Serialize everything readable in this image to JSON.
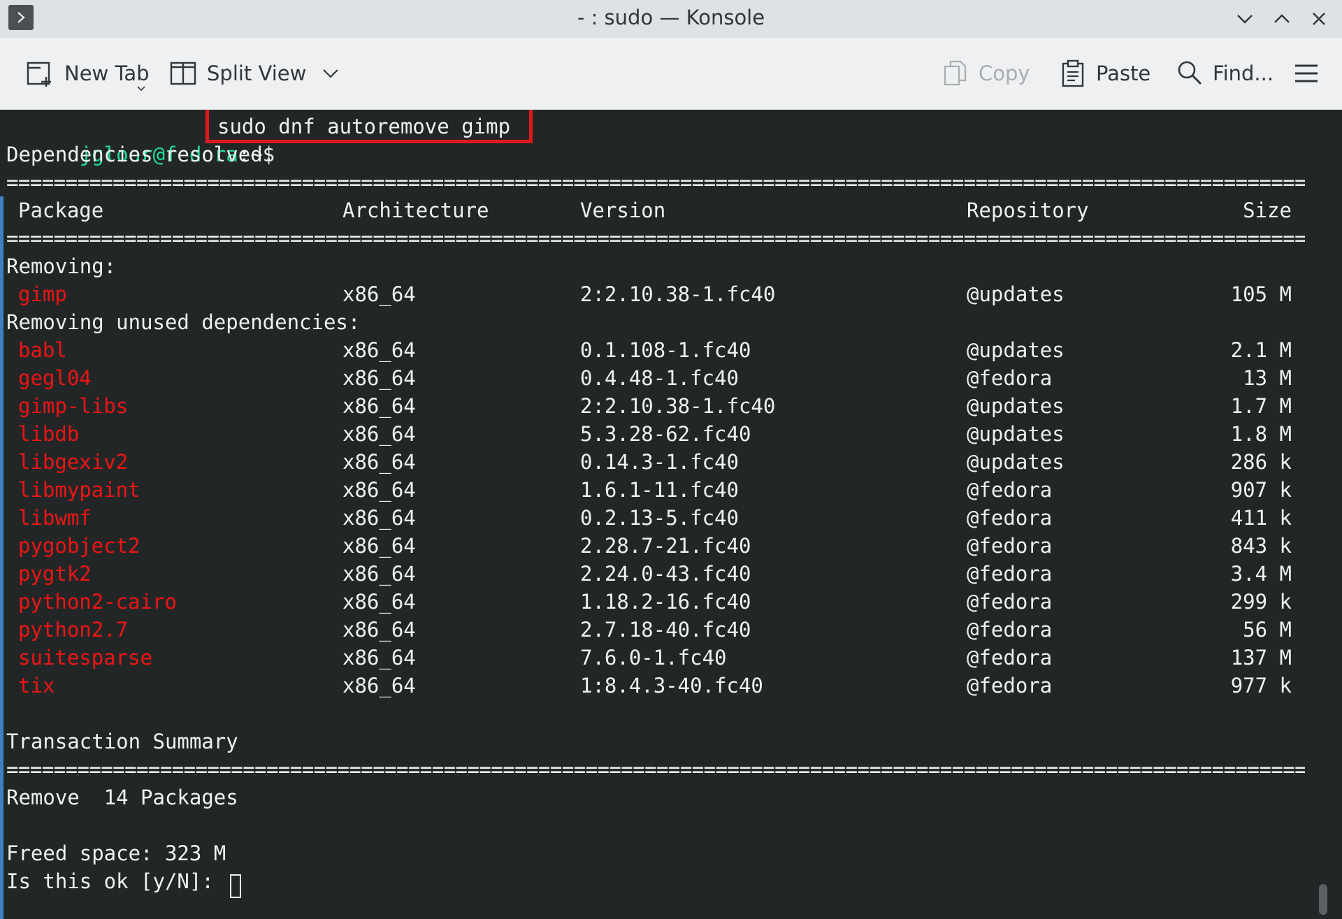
{
  "window": {
    "title": "- : sudo — Konsole",
    "controls": [
      "minimize",
      "maximize",
      "close"
    ]
  },
  "toolbar": {
    "new_tab": "New Tab",
    "split_view": "Split View",
    "copy": "Copy",
    "paste": "Paste",
    "find": "Find...",
    "menu_icon": "hamburger-menu-icon"
  },
  "terminal": {
    "prompt_user": "jgloor@fedora",
    "prompt_suffix": ":~$",
    "command": "sudo dnf autoremove gimp",
    "line_resolved": "Dependencies resolved.",
    "separator": "================================================================================================================",
    "headers": {
      "package": "Package",
      "arch": "Architecture",
      "version": "Version",
      "repo": "Repository",
      "size": "Size"
    },
    "section_removing": "Removing:",
    "section_unused": "Removing unused dependencies:",
    "removing": [
      {
        "name": "gimp",
        "arch": "x86_64",
        "version": "2:2.10.38-1.fc40",
        "repo": "@updates",
        "size": "105 M"
      }
    ],
    "dependencies": [
      {
        "name": "babl",
        "arch": "x86_64",
        "version": "0.1.108-1.fc40",
        "repo": "@updates",
        "size": "2.1 M"
      },
      {
        "name": "gegl04",
        "arch": "x86_64",
        "version": "0.4.48-1.fc40",
        "repo": "@fedora",
        "size": "13 M"
      },
      {
        "name": "gimp-libs",
        "arch": "x86_64",
        "version": "2:2.10.38-1.fc40",
        "repo": "@updates",
        "size": "1.7 M"
      },
      {
        "name": "libdb",
        "arch": "x86_64",
        "version": "5.3.28-62.fc40",
        "repo": "@updates",
        "size": "1.8 M"
      },
      {
        "name": "libgexiv2",
        "arch": "x86_64",
        "version": "0.14.3-1.fc40",
        "repo": "@updates",
        "size": "286 k"
      },
      {
        "name": "libmypaint",
        "arch": "x86_64",
        "version": "1.6.1-11.fc40",
        "repo": "@fedora",
        "size": "907 k"
      },
      {
        "name": "libwmf",
        "arch": "x86_64",
        "version": "0.2.13-5.fc40",
        "repo": "@fedora",
        "size": "411 k"
      },
      {
        "name": "pygobject2",
        "arch": "x86_64",
        "version": "2.28.7-21.fc40",
        "repo": "@fedora",
        "size": "843 k"
      },
      {
        "name": "pygtk2",
        "arch": "x86_64",
        "version": "2.24.0-43.fc40",
        "repo": "@fedora",
        "size": "3.4 M"
      },
      {
        "name": "python2-cairo",
        "arch": "x86_64",
        "version": "1.18.2-16.fc40",
        "repo": "@fedora",
        "size": "299 k"
      },
      {
        "name": "python2.7",
        "arch": "x86_64",
        "version": "2.7.18-40.fc40",
        "repo": "@fedora",
        "size": "56 M"
      },
      {
        "name": "suitesparse",
        "arch": "x86_64",
        "version": "7.6.0-1.fc40",
        "repo": "@fedora",
        "size": "137 M"
      },
      {
        "name": "tix",
        "arch": "x86_64",
        "version": "1:8.4.3-40.fc40",
        "repo": "@fedora",
        "size": "977 k"
      }
    ],
    "summary_title": "Transaction Summary",
    "remove_line": "Remove  14 Packages",
    "freed_line": "Freed space: 323 M",
    "confirm_prompt": "Is this ok [y/N]: "
  },
  "colors": {
    "terminal_bg": "#232627",
    "package_red": "#ed1515",
    "prompt_green": "#1cdc9a",
    "highlight_box": "#e0191f"
  }
}
